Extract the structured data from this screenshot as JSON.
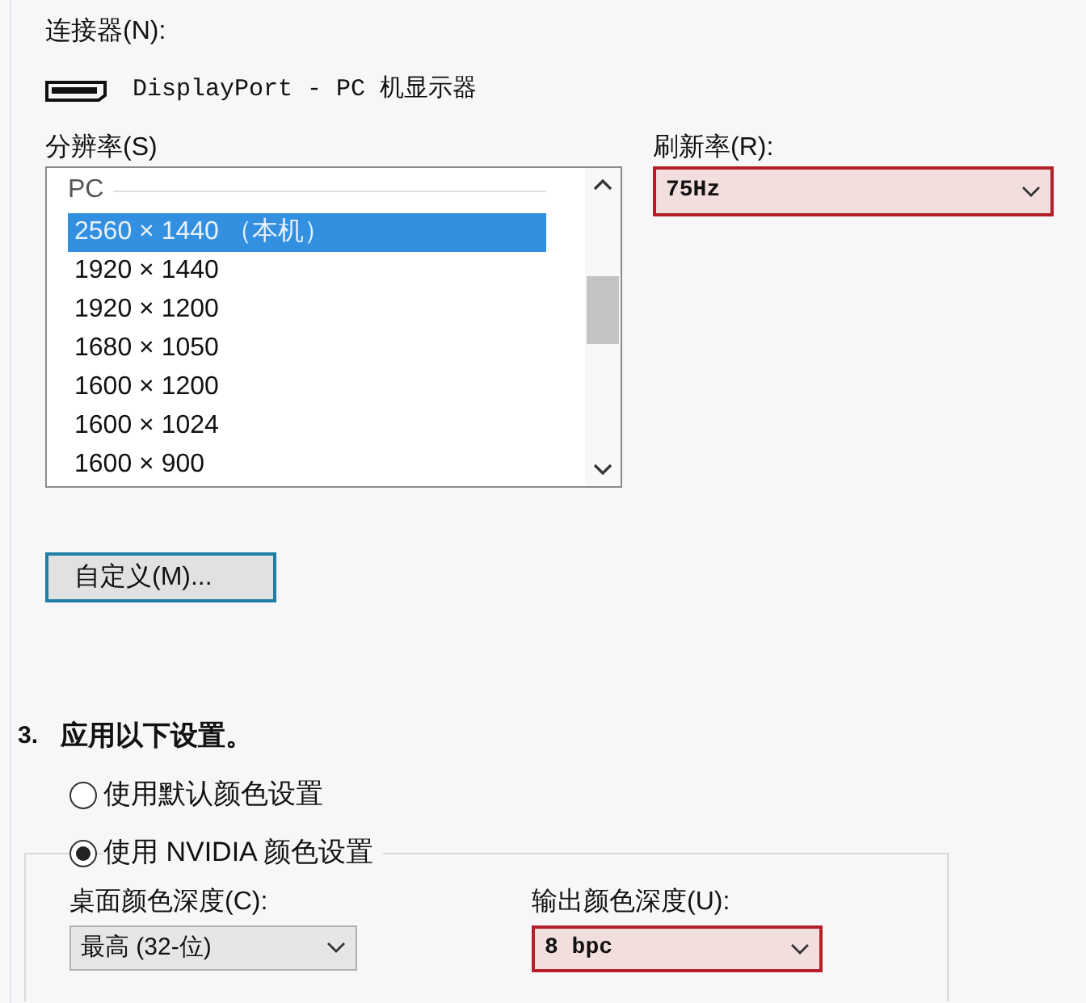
{
  "connector": {
    "label": "连接器(N):",
    "value": "DisplayPort - PC 机显示器"
  },
  "resolution": {
    "label": "分辨率(S)",
    "group": "PC",
    "items": [
      {
        "text": "2560 × 1440 （本机）",
        "selected": true
      },
      {
        "text": "1920 × 1440",
        "selected": false
      },
      {
        "text": "1920 × 1200",
        "selected": false
      },
      {
        "text": "1680 × 1050",
        "selected": false
      },
      {
        "text": "1600 × 1200",
        "selected": false
      },
      {
        "text": "1600 × 1024",
        "selected": false
      },
      {
        "text": "1600 × 900",
        "selected": false
      }
    ]
  },
  "refresh_rate": {
    "label": "刷新率(R):",
    "value": "75Hz",
    "highlighted": true
  },
  "customize_button": "自定义(M)...",
  "step": {
    "number": "3.",
    "title": "应用以下设置。"
  },
  "color_options": [
    {
      "label": "使用默认颜色设置",
      "selected": false
    },
    {
      "label": "使用 NVIDIA 颜色设置",
      "selected": true
    }
  ],
  "desktop_color_depth": {
    "label": "桌面颜色深度(C):",
    "value": "最高 (32-位)",
    "highlighted": false
  },
  "output_color_depth": {
    "label": "输出颜色深度(U):",
    "value": "8 bpc",
    "highlighted": true
  }
}
